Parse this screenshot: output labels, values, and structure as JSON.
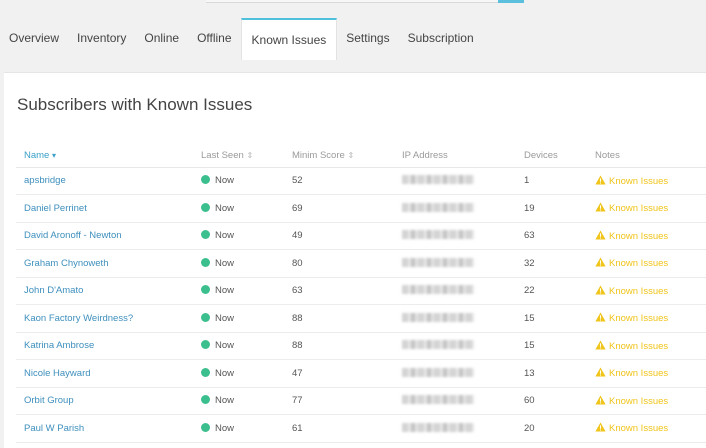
{
  "tabs": [
    {
      "label": "Overview",
      "active": false
    },
    {
      "label": "Inventory",
      "active": false
    },
    {
      "label": "Online",
      "active": false
    },
    {
      "label": "Offline",
      "active": false
    },
    {
      "label": "Known Issues",
      "active": true
    },
    {
      "label": "Settings",
      "active": false
    },
    {
      "label": "Subscription",
      "active": false
    }
  ],
  "panel": {
    "title": "Subscribers with Known Issues"
  },
  "table": {
    "columns": {
      "name": "Name",
      "last_seen": "Last Seen",
      "score": "Minim Score",
      "ip": "IP Address",
      "devices": "Devices",
      "notes": "Notes"
    },
    "rows": [
      {
        "name": "apsbridge",
        "last_seen": "Now",
        "score": "52",
        "devices": "1",
        "notes": "Known Issues"
      },
      {
        "name": "Daniel Perrinet",
        "last_seen": "Now",
        "score": "69",
        "devices": "19",
        "notes": "Known Issues"
      },
      {
        "name": "David Aronoff - Newton",
        "last_seen": "Now",
        "score": "49",
        "devices": "63",
        "notes": "Known Issues"
      },
      {
        "name": "Graham Chynoweth",
        "last_seen": "Now",
        "score": "80",
        "devices": "32",
        "notes": "Known Issues"
      },
      {
        "name": "John D'Amato",
        "last_seen": "Now",
        "score": "63",
        "devices": "22",
        "notes": "Known Issues"
      },
      {
        "name": "Kaon Factory Weirdness?",
        "last_seen": "Now",
        "score": "88",
        "devices": "15",
        "notes": "Known Issues"
      },
      {
        "name": "Katrina Ambrose",
        "last_seen": "Now",
        "score": "88",
        "devices": "15",
        "notes": "Known Issues"
      },
      {
        "name": "Nicole Hayward",
        "last_seen": "Now",
        "score": "47",
        "devices": "13",
        "notes": "Known Issues"
      },
      {
        "name": "Orbit Group",
        "last_seen": "Now",
        "score": "77",
        "devices": "60",
        "notes": "Known Issues"
      },
      {
        "name": "Paul W Parish",
        "last_seen": "Now",
        "score": "61",
        "devices": "20",
        "notes": "Known Issues"
      }
    ]
  },
  "colors": {
    "accent": "#4fc1dc",
    "link": "#3d8fbd",
    "online": "#3cbf8f",
    "warning": "#f0c419"
  },
  "icons": {
    "status": "status-dot-icon",
    "notes": "warning-triangle-icon",
    "sort_active": "caret-down-icon",
    "sort_inactive": "sort-icon"
  }
}
